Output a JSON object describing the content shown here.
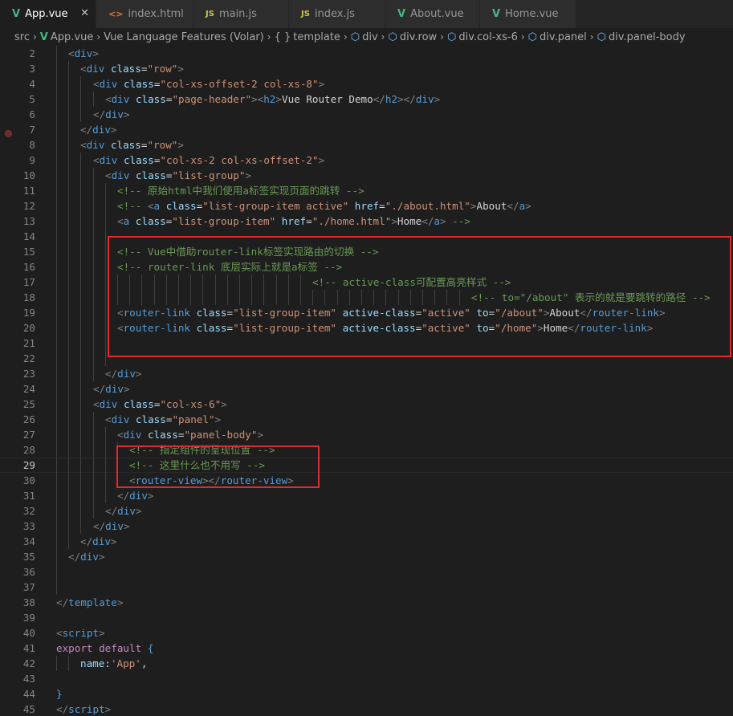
{
  "tabs": [
    {
      "label": "App.vue",
      "icon": "vue-icon",
      "active": true,
      "close": "✕"
    },
    {
      "label": "index.html",
      "icon": "html-icon",
      "active": false
    },
    {
      "label": "main.js",
      "icon": "js-icon",
      "active": false
    },
    {
      "label": "index.js",
      "icon": "js-icon",
      "active": false
    },
    {
      "label": "About.vue",
      "icon": "vue-icon",
      "active": false
    },
    {
      "label": "Home.vue",
      "icon": "vue-icon",
      "active": false
    }
  ],
  "breadcrumb": [
    {
      "label": "src",
      "icon": ""
    },
    {
      "label": "App.vue",
      "icon": "vue-icon"
    },
    {
      "label": "Vue Language Features (Volar)",
      "icon": ""
    },
    {
      "label": "template",
      "icon": "braces-icon"
    },
    {
      "label": "div",
      "icon": "cube-icon"
    },
    {
      "label": "div.row",
      "icon": "cube-icon"
    },
    {
      "label": "div.col-xs-6",
      "icon": "cube-icon"
    },
    {
      "label": "div.panel",
      "icon": "cube-icon"
    },
    {
      "label": "div.panel-body",
      "icon": "cube-icon"
    }
  ],
  "editor": {
    "current_line": 29,
    "breakpoint_line": 4,
    "lines": [
      {
        "n": 2,
        "indent": 1,
        "tokens": [
          [
            "ang",
            "<"
          ],
          [
            "tag",
            "div"
          ],
          [
            "ang",
            ">"
          ]
        ]
      },
      {
        "n": 3,
        "indent": 2,
        "tokens": [
          [
            "ang",
            "<"
          ],
          [
            "tag",
            "div"
          ],
          [
            "txt",
            " "
          ],
          [
            "attr",
            "class"
          ],
          [
            "txt",
            "="
          ],
          [
            "str",
            "\"row\""
          ],
          [
            "ang",
            ">"
          ]
        ]
      },
      {
        "n": 4,
        "indent": 3,
        "tokens": [
          [
            "ang",
            "<"
          ],
          [
            "tag",
            "div"
          ],
          [
            "txt",
            " "
          ],
          [
            "attr",
            "class"
          ],
          [
            "txt",
            "="
          ],
          [
            "str",
            "\"col-xs-offset-2 col-xs-8\""
          ],
          [
            "ang",
            ">"
          ]
        ]
      },
      {
        "n": 5,
        "indent": 4,
        "tokens": [
          [
            "ang",
            "<"
          ],
          [
            "tag",
            "div"
          ],
          [
            "txt",
            " "
          ],
          [
            "attr",
            "class"
          ],
          [
            "txt",
            "="
          ],
          [
            "str",
            "\"page-header\""
          ],
          [
            "ang",
            ">"
          ],
          [
            "ang",
            "<"
          ],
          [
            "tag",
            "h2"
          ],
          [
            "ang",
            ">"
          ],
          [
            "txt",
            "Vue Router Demo"
          ],
          [
            "ang",
            "</"
          ],
          [
            "tag",
            "h2"
          ],
          [
            "ang",
            ">"
          ],
          [
            "ang",
            "</"
          ],
          [
            "tag",
            "div"
          ],
          [
            "ang",
            ">"
          ]
        ]
      },
      {
        "n": 6,
        "indent": 3,
        "tokens": [
          [
            "ang",
            "</"
          ],
          [
            "tag",
            "div"
          ],
          [
            "ang",
            ">"
          ]
        ]
      },
      {
        "n": 7,
        "indent": 2,
        "tokens": [
          [
            "ang",
            "</"
          ],
          [
            "tag",
            "div"
          ],
          [
            "ang",
            ">"
          ]
        ]
      },
      {
        "n": 8,
        "indent": 2,
        "tokens": [
          [
            "ang",
            "<"
          ],
          [
            "tag",
            "div"
          ],
          [
            "txt",
            " "
          ],
          [
            "attr",
            "class"
          ],
          [
            "txt",
            "="
          ],
          [
            "str",
            "\"row\""
          ],
          [
            "ang",
            ">"
          ]
        ]
      },
      {
        "n": 9,
        "indent": 3,
        "tokens": [
          [
            "ang",
            "<"
          ],
          [
            "tag",
            "div"
          ],
          [
            "txt",
            " "
          ],
          [
            "attr",
            "class"
          ],
          [
            "txt",
            "="
          ],
          [
            "str",
            "\"col-xs-2 col-xs-offset-2\""
          ],
          [
            "ang",
            ">"
          ]
        ]
      },
      {
        "n": 10,
        "indent": 4,
        "tokens": [
          [
            "ang",
            "<"
          ],
          [
            "tag",
            "div"
          ],
          [
            "txt",
            " "
          ],
          [
            "attr",
            "class"
          ],
          [
            "txt",
            "="
          ],
          [
            "str",
            "\"list-group\""
          ],
          [
            "ang",
            ">"
          ]
        ]
      },
      {
        "n": 11,
        "indent": 5,
        "tokens": [
          [
            "com",
            "<!-- 原始html中我们使用a标签实现页面的跳转 -->"
          ]
        ]
      },
      {
        "n": 12,
        "indent": 5,
        "tokens": [
          [
            "com",
            "<!-- "
          ],
          [
            "ang",
            "<"
          ],
          [
            "tag",
            "a"
          ],
          [
            "txt",
            " "
          ],
          [
            "attr",
            "class"
          ],
          [
            "txt",
            "="
          ],
          [
            "str",
            "\"list-group-item active\""
          ],
          [
            "txt",
            " "
          ],
          [
            "attr",
            "href"
          ],
          [
            "txt",
            "="
          ],
          [
            "str",
            "\"./about.html\""
          ],
          [
            "ang",
            ">"
          ],
          [
            "txt",
            "About"
          ],
          [
            "ang",
            "</"
          ],
          [
            "tag",
            "a"
          ],
          [
            "ang",
            ">"
          ]
        ]
      },
      {
        "n": 13,
        "indent": 5,
        "tokens": [
          [
            "ang",
            "<"
          ],
          [
            "tag",
            "a"
          ],
          [
            "txt",
            " "
          ],
          [
            "attr",
            "class"
          ],
          [
            "txt",
            "="
          ],
          [
            "str",
            "\"list-group-item\""
          ],
          [
            "txt",
            " "
          ],
          [
            "attr",
            "href"
          ],
          [
            "txt",
            "="
          ],
          [
            "str",
            "\"./home.html\""
          ],
          [
            "ang",
            ">"
          ],
          [
            "txt",
            "Home"
          ],
          [
            "ang",
            "</"
          ],
          [
            "tag",
            "a"
          ],
          [
            "ang",
            ">"
          ],
          [
            "com",
            " -->"
          ]
        ]
      },
      {
        "n": 14,
        "indent": 5,
        "tokens": []
      },
      {
        "n": 15,
        "indent": 5,
        "tokens": [
          [
            "com",
            "<!-- Vue中借助router-link标签实现路由的切换 -->"
          ]
        ]
      },
      {
        "n": 16,
        "indent": 5,
        "tokens": [
          [
            "com",
            "<!-- router-link 底层实际上就是a标签 -->"
          ]
        ]
      },
      {
        "n": 17,
        "indent": 21,
        "tokens": [
          [
            "com",
            "<!-- active-class可配置高亮样式 -->"
          ]
        ]
      },
      {
        "n": 18,
        "indent": 34,
        "tokens": [
          [
            "com",
            "<!-- to=\"/about\" 表示的就是要跳转的路径 -->"
          ]
        ]
      },
      {
        "n": 19,
        "indent": 5,
        "tokens": [
          [
            "ang",
            "<"
          ],
          [
            "tag",
            "router-link"
          ],
          [
            "txt",
            " "
          ],
          [
            "attr",
            "class"
          ],
          [
            "txt",
            "="
          ],
          [
            "str",
            "\"list-group-item\""
          ],
          [
            "txt",
            " "
          ],
          [
            "attr",
            "active-class"
          ],
          [
            "txt",
            "="
          ],
          [
            "str",
            "\"active\""
          ],
          [
            "txt",
            " "
          ],
          [
            "attr",
            "to"
          ],
          [
            "txt",
            "="
          ],
          [
            "str",
            "\"/about\""
          ],
          [
            "ang",
            ">"
          ],
          [
            "txt",
            "About"
          ],
          [
            "ang",
            "</"
          ],
          [
            "tag",
            "router-link"
          ],
          [
            "ang",
            ">"
          ]
        ]
      },
      {
        "n": 20,
        "indent": 5,
        "tokens": [
          [
            "ang",
            "<"
          ],
          [
            "tag",
            "router-link"
          ],
          [
            "txt",
            " "
          ],
          [
            "attr",
            "class"
          ],
          [
            "txt",
            "="
          ],
          [
            "str",
            "\"list-group-item\""
          ],
          [
            "txt",
            " "
          ],
          [
            "attr",
            "active-class"
          ],
          [
            "txt",
            "="
          ],
          [
            "str",
            "\"active\""
          ],
          [
            "txt",
            " "
          ],
          [
            "attr",
            "to"
          ],
          [
            "txt",
            "="
          ],
          [
            "str",
            "\"/home\""
          ],
          [
            "ang",
            ">"
          ],
          [
            "txt",
            "Home"
          ],
          [
            "ang",
            "</"
          ],
          [
            "tag",
            "router-link"
          ],
          [
            "ang",
            ">"
          ]
        ]
      },
      {
        "n": 21,
        "indent": 5,
        "tokens": []
      },
      {
        "n": 22,
        "indent": 5,
        "tokens": []
      },
      {
        "n": 23,
        "indent": 4,
        "tokens": [
          [
            "ang",
            "</"
          ],
          [
            "tag",
            "div"
          ],
          [
            "ang",
            ">"
          ]
        ]
      },
      {
        "n": 24,
        "indent": 3,
        "tokens": [
          [
            "ang",
            "</"
          ],
          [
            "tag",
            "div"
          ],
          [
            "ang",
            ">"
          ]
        ]
      },
      {
        "n": 25,
        "indent": 3,
        "tokens": [
          [
            "ang",
            "<"
          ],
          [
            "tag",
            "div"
          ],
          [
            "txt",
            " "
          ],
          [
            "attr",
            "class"
          ],
          [
            "txt",
            "="
          ],
          [
            "str",
            "\"col-xs-6\""
          ],
          [
            "ang",
            ">"
          ]
        ]
      },
      {
        "n": 26,
        "indent": 4,
        "tokens": [
          [
            "ang",
            "<"
          ],
          [
            "tag",
            "div"
          ],
          [
            "txt",
            " "
          ],
          [
            "attr",
            "class"
          ],
          [
            "txt",
            "="
          ],
          [
            "str",
            "\"panel\""
          ],
          [
            "ang",
            ">"
          ]
        ]
      },
      {
        "n": 27,
        "indent": 5,
        "tokens": [
          [
            "ang",
            "<"
          ],
          [
            "tag",
            "div"
          ],
          [
            "txt",
            " "
          ],
          [
            "attr",
            "class"
          ],
          [
            "txt",
            "="
          ],
          [
            "str",
            "\"panel-body\""
          ],
          [
            "ang",
            ">"
          ]
        ]
      },
      {
        "n": 28,
        "indent": 6,
        "tokens": [
          [
            "com",
            "<!-- 指定组件的呈现位置 -->"
          ]
        ]
      },
      {
        "n": 29,
        "indent": 6,
        "tokens": [
          [
            "com",
            "<!-- 这里什么也不用写 -->"
          ]
        ]
      },
      {
        "n": 30,
        "indent": 6,
        "tokens": [
          [
            "ang",
            "<"
          ],
          [
            "tag",
            "router-view"
          ],
          [
            "ang",
            ">"
          ],
          [
            "ang",
            "</"
          ],
          [
            "tag",
            "router-view"
          ],
          [
            "ang",
            ">"
          ]
        ]
      },
      {
        "n": 31,
        "indent": 5,
        "tokens": [
          [
            "ang",
            "</"
          ],
          [
            "tag",
            "div"
          ],
          [
            "ang",
            ">"
          ]
        ]
      },
      {
        "n": 32,
        "indent": 4,
        "tokens": [
          [
            "ang",
            "</"
          ],
          [
            "tag",
            "div"
          ],
          [
            "ang",
            ">"
          ]
        ]
      },
      {
        "n": 33,
        "indent": 3,
        "tokens": [
          [
            "ang",
            "</"
          ],
          [
            "tag",
            "div"
          ],
          [
            "ang",
            ">"
          ]
        ]
      },
      {
        "n": 34,
        "indent": 2,
        "tokens": [
          [
            "ang",
            "</"
          ],
          [
            "tag",
            "div"
          ],
          [
            "ang",
            ">"
          ]
        ]
      },
      {
        "n": 35,
        "indent": 1,
        "tokens": [
          [
            "ang",
            "</"
          ],
          [
            "tag",
            "div"
          ],
          [
            "ang",
            ">"
          ]
        ]
      },
      {
        "n": 36,
        "indent": 1,
        "tokens": []
      },
      {
        "n": 37,
        "indent": 1,
        "tokens": []
      },
      {
        "n": 38,
        "indent": 0,
        "tokens": [
          [
            "ang",
            "</"
          ],
          [
            "tag",
            "template"
          ],
          [
            "ang",
            ">"
          ]
        ]
      },
      {
        "n": 39,
        "indent": 0,
        "tokens": []
      },
      {
        "n": 40,
        "indent": 0,
        "tokens": [
          [
            "ang",
            "<"
          ],
          [
            "tag",
            "script"
          ],
          [
            "ang",
            ">"
          ]
        ]
      },
      {
        "n": 41,
        "indent": 0,
        "tokens": [
          [
            "kw",
            "export"
          ],
          [
            "txt",
            " "
          ],
          [
            "kw",
            "default"
          ],
          [
            "txt",
            " "
          ],
          [
            "brace",
            "{"
          ]
        ]
      },
      {
        "n": 42,
        "indent": 2,
        "tokens": [
          [
            "prop",
            "name"
          ],
          [
            "txt",
            ":"
          ],
          [
            "str",
            "'App'"
          ],
          [
            "txt",
            ","
          ]
        ]
      },
      {
        "n": 43,
        "indent": 0,
        "tokens": []
      },
      {
        "n": 44,
        "indent": 0,
        "tokens": [
          [
            "brace",
            "}"
          ]
        ]
      },
      {
        "n": 45,
        "indent": 0,
        "tokens": [
          [
            "ang",
            "</"
          ],
          [
            "tag",
            "script"
          ],
          [
            "ang",
            ">"
          ]
        ]
      }
    ]
  },
  "annotations": [
    {
      "label": "highlight-router-link"
    },
    {
      "label": "highlight-router-view"
    }
  ]
}
